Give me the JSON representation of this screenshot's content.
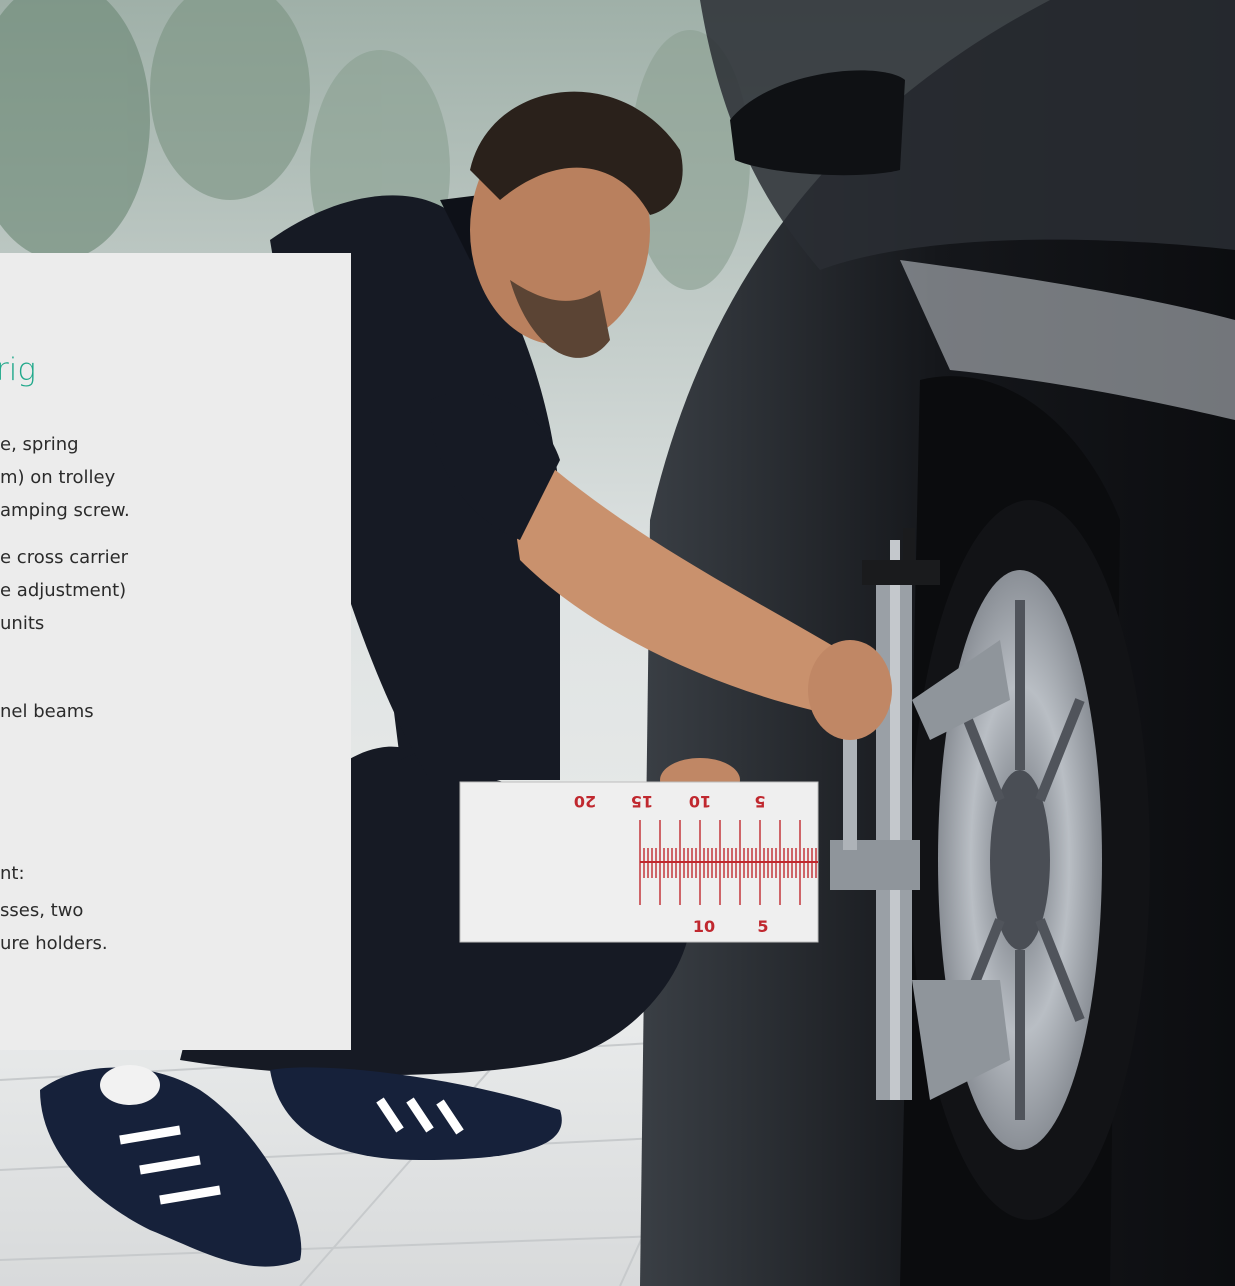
{
  "panel": {
    "title": "rig",
    "lines": [
      "e, spring",
      "m) on trolley",
      "amping screw.",
      "e cross carrier",
      "e adjustment)",
      "units",
      "nel beams",
      "nt:",
      "sses, two",
      "ure holders."
    ]
  },
  "gauge": {
    "scale_top": [
      "20",
      "15",
      "10",
      "5"
    ],
    "scale_bottom": [
      "10",
      "5"
    ]
  },
  "colors": {
    "accent": "#1fa88a",
    "panel_bg": "#ececec",
    "text": "#2b2b2b",
    "car_body": "#1c1e22",
    "shirt": "#161a24",
    "gauge_red": "#c0282f"
  }
}
